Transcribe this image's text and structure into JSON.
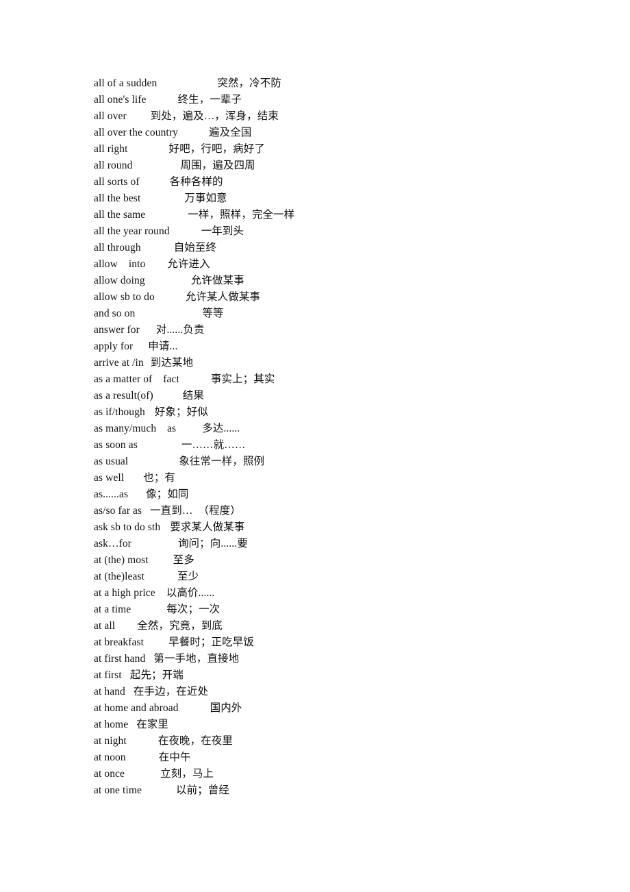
{
  "document": {
    "kind": "bilingual-phrase-glossary",
    "page_background": "#ffffff",
    "text_color": "#101010",
    "entries": [
      {
        "term": "all of a sudden",
        "gap": 88,
        "gloss": "突然，冷不防"
      },
      {
        "term": "all one's life",
        "gap": 46,
        "gloss": "终生，一辈子"
      },
      {
        "term": "all over",
        "gap": 35,
        "gloss": "到处，遍及…，浑身，结束"
      },
      {
        "term": "all over the country",
        "gap": 45,
        "gloss": "遍及全国"
      },
      {
        "term": "all right",
        "gap": 60,
        "gloss": "好吧，行吧，病好了"
      },
      {
        "term": "all round",
        "gap": 70,
        "gloss": "周围，遍及四周"
      },
      {
        "term": "all sorts of",
        "gap": 44,
        "gloss": "各种各样的"
      },
      {
        "term": "all the best",
        "gap": 64,
        "gloss": "万事如意"
      },
      {
        "term": "all the same",
        "gap": 62,
        "gloss": "一样，照样，完全一样"
      },
      {
        "term": "all the year round",
        "gap": 46,
        "gloss": "一年到头"
      },
      {
        "term": "all through",
        "gap": 48,
        "gloss": "自始至终"
      },
      {
        "term": "allow    into",
        "gap": 32,
        "gloss": "允许进入"
      },
      {
        "term": "allow doing",
        "gap": 67,
        "gloss": "允许做某事"
      },
      {
        "term": "allow sb to do",
        "gap": 45,
        "gloss": "允许某人做某事"
      },
      {
        "term": "and so on",
        "gap": 98,
        "gloss": "等等"
      },
      {
        "term": "answer for",
        "gap": 24,
        "gloss": "对......负责"
      },
      {
        "term": "apply for",
        "gap": 22,
        "gloss": "申请..."
      },
      {
        "term": "arrive at /in",
        "gap": 10,
        "gloss": "到达某地"
      },
      {
        "term": "as a matter of    fact",
        "gap": 46,
        "gloss": "事实上；其实"
      },
      {
        "term": "as a result(of)",
        "gap": 43,
        "gloss": "结果"
      },
      {
        "term": "as if/though",
        "gap": 14,
        "gloss": "好象；好似"
      },
      {
        "term": "as many/much    as",
        "gap": 38,
        "gloss": "多达......"
      },
      {
        "term": "as soon as",
        "gap": 64,
        "gloss": "一……就……"
      },
      {
        "term": "as usual",
        "gap": 74,
        "gloss": "象往常一样，照例"
      },
      {
        "term": "as well",
        "gap": 28,
        "gloss": "也；有"
      },
      {
        "term": "as......as",
        "gap": 26,
        "gloss": "像；如同"
      },
      {
        "term": "as/so far as",
        "gap": 12,
        "gloss": "一直到…  （程度）"
      },
      {
        "term": "ask sb to do sth",
        "gap": 14,
        "gloss": "要求某人做某事"
      },
      {
        "term": "ask…for",
        "gap": 68,
        "gloss": "询问；向......要"
      },
      {
        "term": "at (the) most",
        "gap": 36,
        "gloss": "至多"
      },
      {
        "term": "at (the)least",
        "gap": 48,
        "gloss": "至少"
      },
      {
        "term": "at a high price",
        "gap": 16,
        "gloss": "以高价......"
      },
      {
        "term": "at a time",
        "gap": 52,
        "gloss": "每次；一次"
      },
      {
        "term": "at all",
        "gap": 32,
        "gloss": "全然，究竟，到底"
      },
      {
        "term": "at breakfast",
        "gap": 36,
        "gloss": "早餐时；正吃早饭"
      },
      {
        "term": "at first hand",
        "gap": 12,
        "gloss": "第一手地，直接地"
      },
      {
        "term": "at first",
        "gap": 12,
        "gloss": "起先；开端"
      },
      {
        "term": "at hand",
        "gap": 12,
        "gloss": "在手边，在近处"
      },
      {
        "term": "at home and abroad",
        "gap": 46,
        "gloss": "国内外"
      },
      {
        "term": "at home",
        "gap": 12,
        "gloss": "在家里"
      },
      {
        "term": "at night",
        "gap": 46,
        "gloss": "在夜晚，在夜里"
      },
      {
        "term": "at noon",
        "gap": 48,
        "gloss": "在中午"
      },
      {
        "term": "at once",
        "gap": 52,
        "gloss": "立刻，马上"
      },
      {
        "term": "at one time",
        "gap": 50,
        "gloss": "以前；曾经"
      }
    ]
  }
}
